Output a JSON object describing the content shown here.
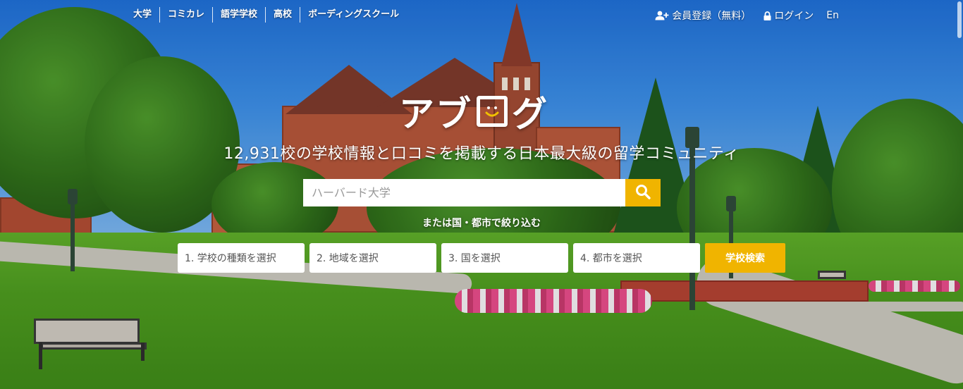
{
  "nav": {
    "categories": [
      {
        "label": "大学"
      },
      {
        "label": "コミカレ"
      },
      {
        "label": "語学学校"
      },
      {
        "label": "高校"
      },
      {
        "label": "ボーディングスクール"
      }
    ],
    "register_label": "会員登録（無料）",
    "login_label": "ログイン",
    "language_label": "En"
  },
  "hero": {
    "logo_text_left": "アブ",
    "logo_text_right": "グ",
    "tagline": "12,931校の学校情報と口コミを掲載する日本最大級の留学コミュニティ"
  },
  "search": {
    "placeholder": "ハーバード大学",
    "value": ""
  },
  "filters": {
    "label": "または国・都市で絞り込む",
    "selects": [
      {
        "label": "1. 学校の種類を選択"
      },
      {
        "label": "2. 地域を選択"
      },
      {
        "label": "3. 国を選択"
      },
      {
        "label": "4. 都市を選択"
      }
    ],
    "submit_label": "学校検索"
  },
  "colors": {
    "accent": "#f0b400",
    "text_on_image": "#ffffff"
  },
  "icons": {
    "register": "user-plus-icon",
    "login": "lock-icon",
    "search": "search-icon"
  }
}
